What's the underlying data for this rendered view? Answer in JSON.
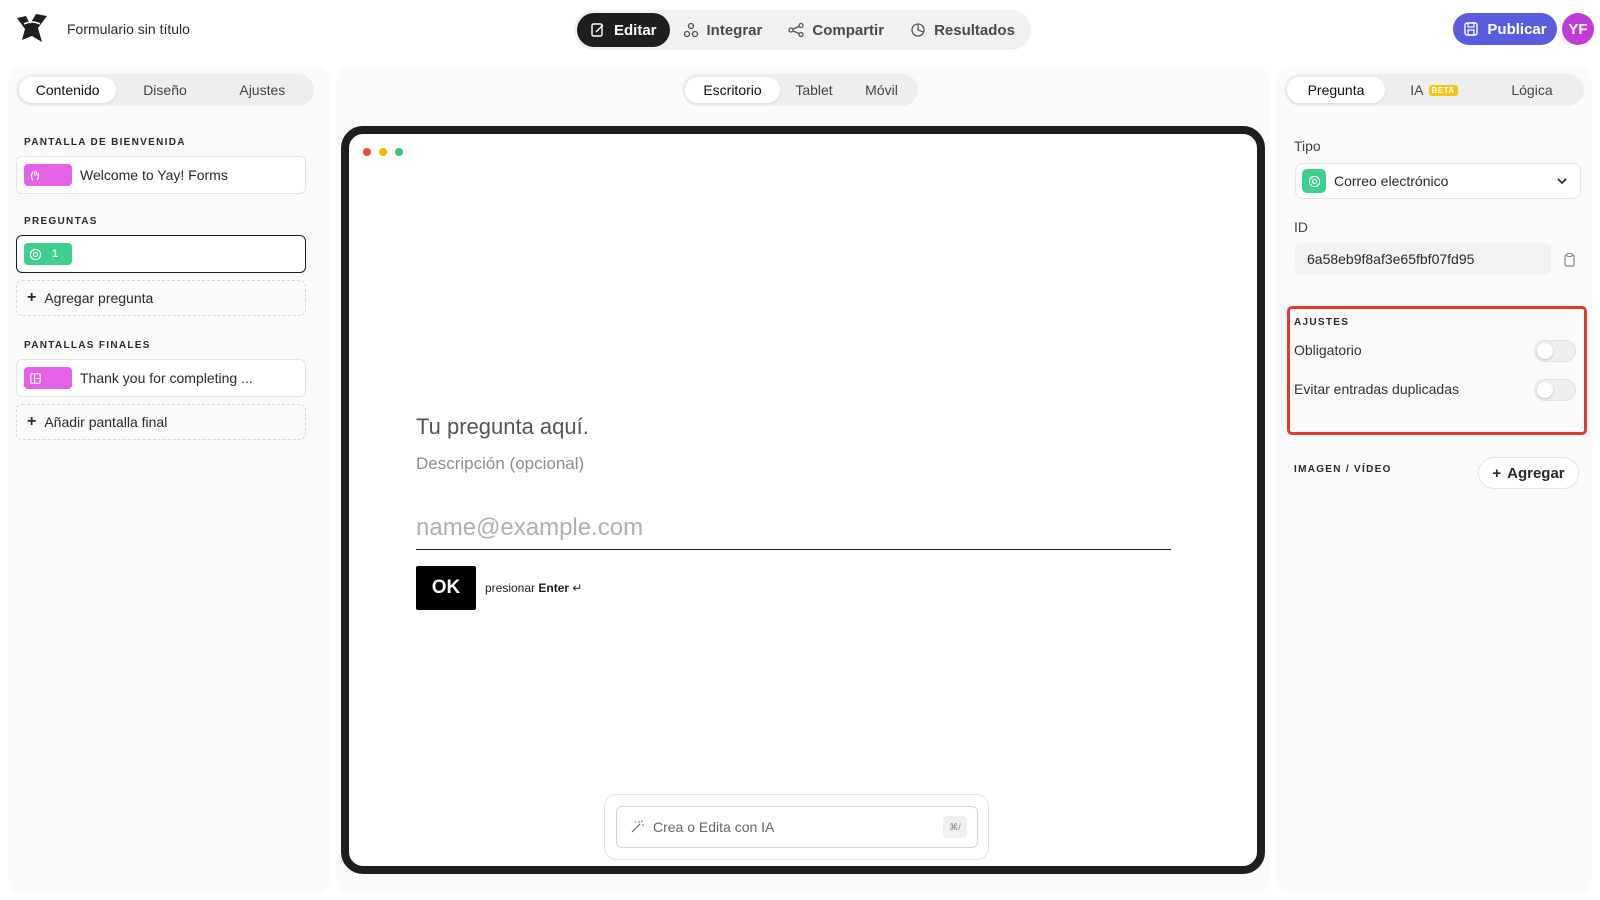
{
  "header": {
    "form_title": "Formulario sin título",
    "tabs": [
      {
        "label": "Editar",
        "icon": "edit-icon",
        "active": true
      },
      {
        "label": "Integrar",
        "icon": "integrate-icon",
        "active": false
      },
      {
        "label": "Compartir",
        "icon": "share-icon",
        "active": false
      },
      {
        "label": "Resultados",
        "icon": "results-icon",
        "active": false
      }
    ],
    "publish_label": "Publicar",
    "avatar_initials": "YF"
  },
  "left": {
    "tabs": [
      {
        "label": "Contenido",
        "active": true
      },
      {
        "label": "Diseño",
        "active": false
      },
      {
        "label": "Ajustes",
        "active": false
      }
    ],
    "welcome_title": "PANTALLA DE BIENVENIDA",
    "welcome_item": "Welcome to Yay! Forms",
    "questions_title": "PREGUNTAS",
    "question_number": "1",
    "add_question": "Agregar pregunta",
    "endings_title": "PANTALLAS FINALES",
    "ending_item": "Thank you for completing ...",
    "add_ending": "Añadir pantalla final"
  },
  "center": {
    "device_tabs": [
      {
        "label": "Escritorio",
        "active": true
      },
      {
        "label": "Tablet",
        "active": false
      },
      {
        "label": "Móvil",
        "active": false
      }
    ],
    "question_title": "Tu pregunta aquí.",
    "question_desc": "Descripción (opcional)",
    "input_placeholder": "name@example.com",
    "ok_label": "OK",
    "hint_prefix": "presionar",
    "hint_key": "Enter",
    "hint_symbol": "↵",
    "ai_placeholder": "Crea o Edita con IA",
    "ai_shortcut": "⌘/"
  },
  "right": {
    "tabs": [
      {
        "label": "Pregunta",
        "active": true
      },
      {
        "label": "IA",
        "active": false,
        "badge": "BETA"
      },
      {
        "label": "Lógica",
        "active": false
      }
    ],
    "type_label": "Tipo",
    "type_value": "Correo electrónico",
    "id_label": "ID",
    "id_value": "6a58eb9f8af3e65fbf07fd95",
    "settings_title": "AJUSTES",
    "settings": [
      {
        "label": "Obligatorio",
        "on": false
      },
      {
        "label": "Evitar entradas duplicadas",
        "on": false
      }
    ],
    "media_title": "IMAGEN / VÍDEO",
    "media_add": "Agregar"
  },
  "colors": {
    "accent": "#5b5bde",
    "avatar": "#c23bd8",
    "highlight_border": "#e03a2f",
    "email_chip": "#3ecf8e",
    "screen_chip": "#e562e8",
    "beta": "#f5c518"
  }
}
